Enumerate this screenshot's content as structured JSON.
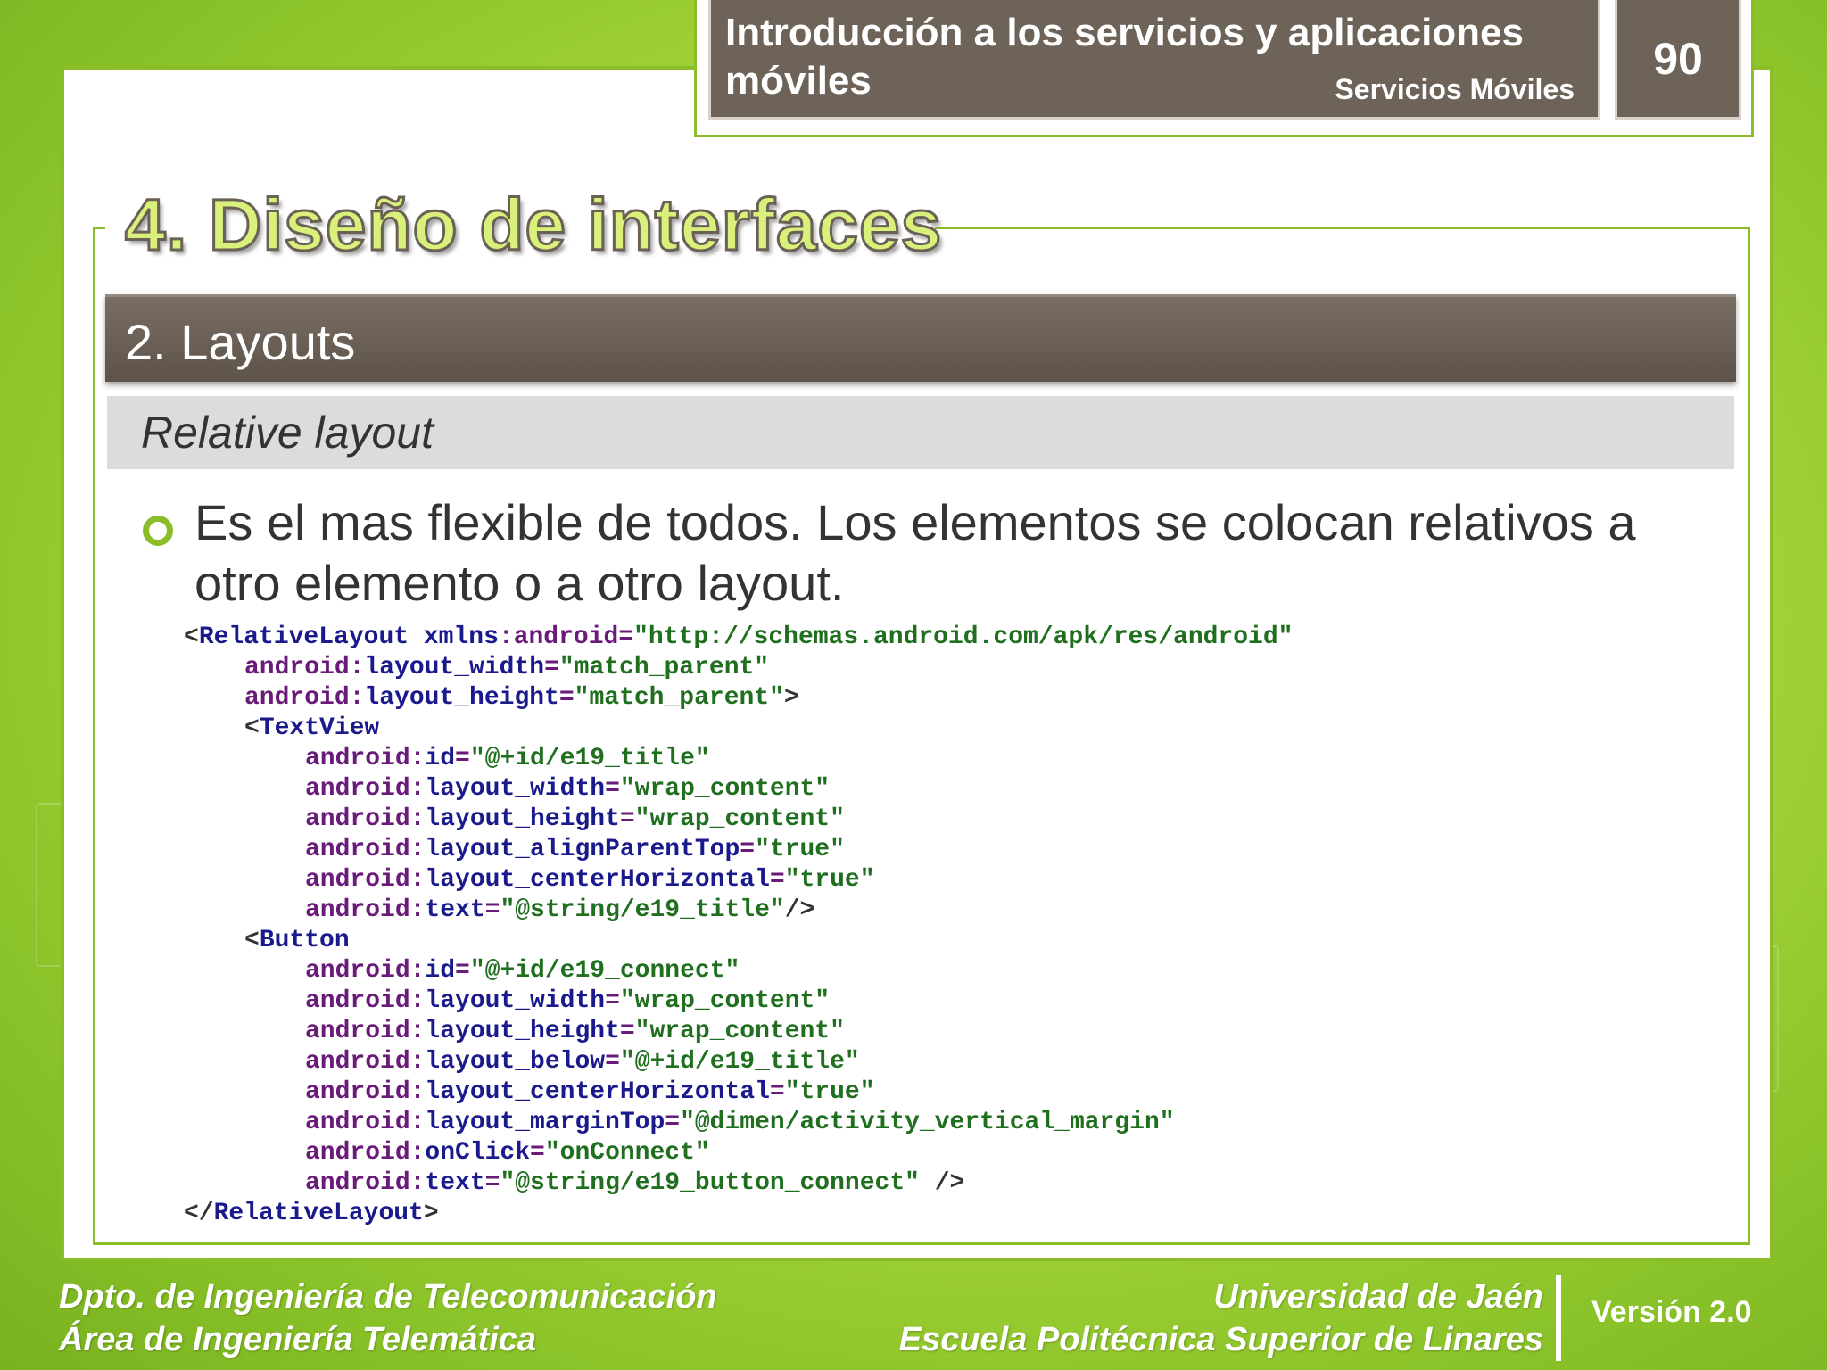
{
  "header": {
    "title": "Introducción a los servicios y aplicaciones móviles",
    "subtitle": "Servicios Móviles",
    "page_number": "90"
  },
  "section": {
    "title": "4. Diseño de interfaces",
    "subheading": "2. Layouts",
    "subsubheading": "Relative layout"
  },
  "body": {
    "bullet": "Es el mas flexible de todos. Los elementos se colocan relativos a otro elemento o a otro layout."
  },
  "code": [
    {
      "indent": 0,
      "tokens": [
        [
          "punct",
          "<"
        ],
        [
          "tag",
          "RelativeLayout"
        ],
        [
          "punct",
          " "
        ],
        [
          "attrname",
          "xmlns"
        ],
        [
          "attr",
          ":android="
        ],
        [
          "val",
          "\"http://schemas.android.com/apk/res/android\""
        ]
      ]
    },
    {
      "indent": 1,
      "tokens": [
        [
          "attr",
          "android:"
        ],
        [
          "attrname",
          "layout_width"
        ],
        [
          "attr",
          "="
        ],
        [
          "val",
          "\"match_parent\""
        ]
      ]
    },
    {
      "indent": 1,
      "tokens": [
        [
          "attr",
          "android:"
        ],
        [
          "attrname",
          "layout_height"
        ],
        [
          "attr",
          "="
        ],
        [
          "val",
          "\"match_parent\""
        ],
        [
          "punct",
          ">"
        ]
      ]
    },
    {
      "indent": 1,
      "tokens": [
        [
          "punct",
          "<"
        ],
        [
          "tag",
          "TextView"
        ]
      ]
    },
    {
      "indent": 2,
      "tokens": [
        [
          "attr",
          "android:"
        ],
        [
          "attrname",
          "id"
        ],
        [
          "attr",
          "="
        ],
        [
          "val",
          "\"@+id/e19_title\""
        ]
      ]
    },
    {
      "indent": 2,
      "tokens": [
        [
          "attr",
          "android:"
        ],
        [
          "attrname",
          "layout_width"
        ],
        [
          "attr",
          "="
        ],
        [
          "val",
          "\"wrap_content\""
        ]
      ]
    },
    {
      "indent": 2,
      "tokens": [
        [
          "attr",
          "android:"
        ],
        [
          "attrname",
          "layout_height"
        ],
        [
          "attr",
          "="
        ],
        [
          "val",
          "\"wrap_content\""
        ]
      ]
    },
    {
      "indent": 2,
      "tokens": [
        [
          "attr",
          "android:"
        ],
        [
          "attrname",
          "layout_alignParentTop"
        ],
        [
          "attr",
          "="
        ],
        [
          "val",
          "\"true\""
        ]
      ]
    },
    {
      "indent": 2,
      "tokens": [
        [
          "attr",
          "android:"
        ],
        [
          "attrname",
          "layout_centerHorizontal"
        ],
        [
          "attr",
          "="
        ],
        [
          "val",
          "\"true\""
        ]
      ]
    },
    {
      "indent": 2,
      "tokens": [
        [
          "attr",
          "android:"
        ],
        [
          "attrname",
          "text"
        ],
        [
          "attr",
          "="
        ],
        [
          "val",
          "\"@string/e19_title\""
        ],
        [
          "punct",
          "/>"
        ]
      ]
    },
    {
      "indent": 1,
      "tokens": [
        [
          "punct",
          "<"
        ],
        [
          "tag",
          "Button"
        ]
      ]
    },
    {
      "indent": 2,
      "tokens": [
        [
          "attr",
          "android:"
        ],
        [
          "attrname",
          "id"
        ],
        [
          "attr",
          "="
        ],
        [
          "val",
          "\"@+id/e19_connect\""
        ]
      ]
    },
    {
      "indent": 2,
      "tokens": [
        [
          "attr",
          "android:"
        ],
        [
          "attrname",
          "layout_width"
        ],
        [
          "attr",
          "="
        ],
        [
          "val",
          "\"wrap_content\""
        ]
      ]
    },
    {
      "indent": 2,
      "tokens": [
        [
          "attr",
          "android:"
        ],
        [
          "attrname",
          "layout_height"
        ],
        [
          "attr",
          "="
        ],
        [
          "val",
          "\"wrap_content\""
        ]
      ]
    },
    {
      "indent": 2,
      "tokens": [
        [
          "attr",
          "android:"
        ],
        [
          "attrname",
          "layout_below"
        ],
        [
          "attr",
          "="
        ],
        [
          "val",
          "\"@+id/e19_title\""
        ]
      ]
    },
    {
      "indent": 2,
      "tokens": [
        [
          "attr",
          "android:"
        ],
        [
          "attrname",
          "layout_centerHorizontal"
        ],
        [
          "attr",
          "="
        ],
        [
          "val",
          "\"true\""
        ]
      ]
    },
    {
      "indent": 2,
      "tokens": [
        [
          "attr",
          "android:"
        ],
        [
          "attrname",
          "layout_marginTop"
        ],
        [
          "attr",
          "="
        ],
        [
          "val",
          "\"@dimen/activity_vertical_margin\""
        ]
      ]
    },
    {
      "indent": 2,
      "tokens": [
        [
          "attr",
          "android:"
        ],
        [
          "attrname",
          "onClick"
        ],
        [
          "attr",
          "="
        ],
        [
          "val",
          "\"onConnect\""
        ]
      ]
    },
    {
      "indent": 2,
      "tokens": [
        [
          "attr",
          "android:"
        ],
        [
          "attrname",
          "text"
        ],
        [
          "attr",
          "="
        ],
        [
          "val",
          "\"@string/e19_button_connect\""
        ],
        [
          "punct",
          " />"
        ]
      ]
    },
    {
      "indent": 0,
      "tokens": [
        [
          "punct",
          "</"
        ],
        [
          "tag",
          "RelativeLayout"
        ],
        [
          "punct",
          ">"
        ]
      ]
    }
  ],
  "footer": {
    "left_line1": "Dpto. de Ingeniería de Telecomunicación",
    "left_line2": "Área de Ingeniería Telemática",
    "right_line1": "Universidad de Jaén",
    "right_line2": "Escuela Politécnica Superior de Linares",
    "version": "Versión 2.0"
  },
  "colors": {
    "background_green": "#a9d83c",
    "frame_green": "#8bbd2b",
    "header_brown": "#6e6359",
    "title_fill": "#d9f07a"
  }
}
